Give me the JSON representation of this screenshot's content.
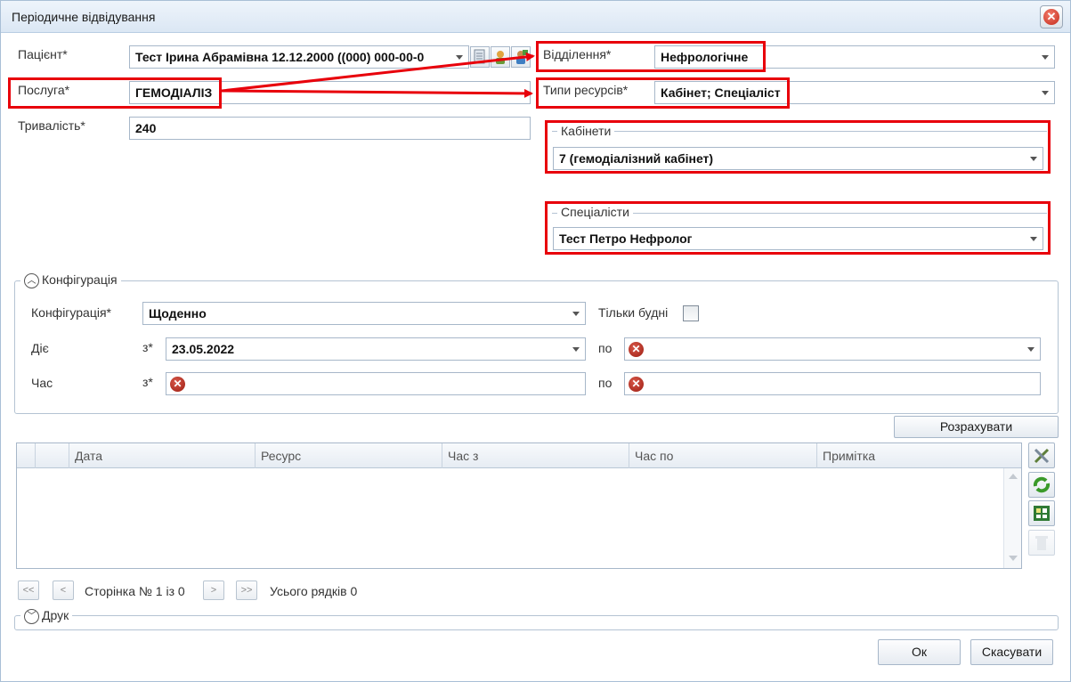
{
  "window": {
    "title": "Періодичне відвідування",
    "close_icon": "close-icon"
  },
  "patient": {
    "label": "Пацієнт*",
    "value": "Тест Ірина Абрамівна 12.12.2000 ((000) 000-00-0"
  },
  "service": {
    "label": "Послуга*",
    "value": "ГЕМОДІАЛІЗ"
  },
  "duration": {
    "label": "Тривалість*",
    "value": "240"
  },
  "department": {
    "label": "Відділення*",
    "value": "Нефрологічне"
  },
  "resource_types": {
    "label": "Типи ресурсів*",
    "value": "Кабінет; Спеціаліст"
  },
  "cabinets": {
    "title": "Кабінети",
    "value": "7 (гемодіалізний кабінет)"
  },
  "specialists": {
    "title": "Спеціалісти",
    "value": "Тест Петро Нефролог"
  },
  "configuration": {
    "group_title": "Конфігурація",
    "label": "Конфігурація*",
    "value": "Щоденно",
    "weekdays_label": "Тільки будні",
    "weekdays_checked": false,
    "active_label": "Діє",
    "from_label": "з*",
    "to_label": "по",
    "active_from": "23.05.2022",
    "time_label": "Час"
  },
  "calculate_button": "Розрахувати",
  "grid": {
    "columns": [
      "Дата",
      "Ресурс",
      "Час з",
      "Час по",
      "Примітка"
    ],
    "rows": []
  },
  "pager": {
    "first": "<<",
    "prev": "<",
    "next": ">",
    "last": ">>",
    "page_text": "Сторінка № 1 із 0",
    "total_text": "Усього рядків 0"
  },
  "print_group": {
    "title": "Друк"
  },
  "buttons": {
    "ok": "Ок",
    "cancel": "Скасувати"
  },
  "colors": {
    "annotation_red": "#e8000b",
    "border": "#a7b7c9",
    "titlebar": "#dbe7f4"
  }
}
